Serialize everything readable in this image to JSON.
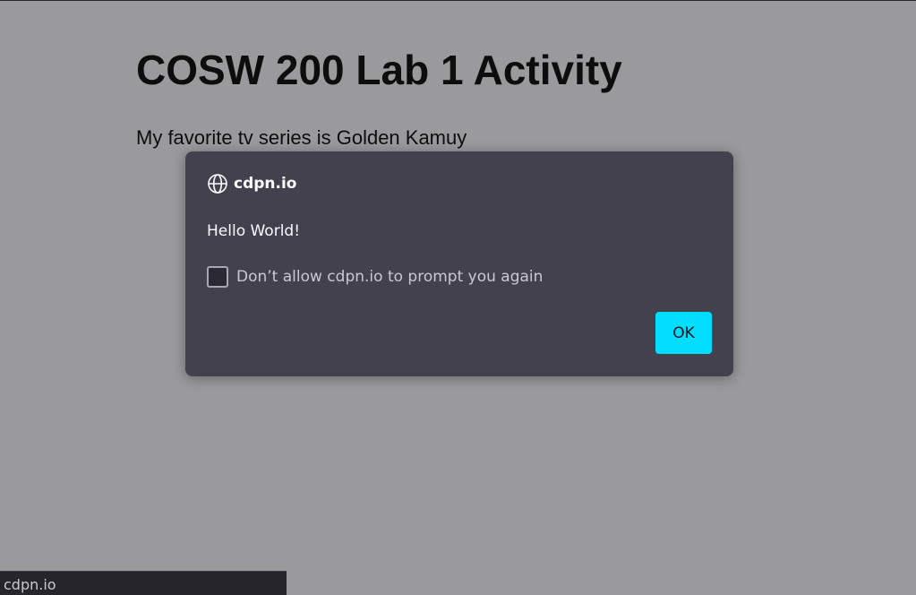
{
  "page": {
    "title": "COSW 200 Lab 1 Activity",
    "paragraph": "My favorite tv series is Golden Kamuy"
  },
  "dialog": {
    "origin": "cdpn.io",
    "origin_icon": "globe-icon",
    "message": "Hello World!",
    "checkbox_label": "Don’t allow cdpn.io to prompt you again",
    "checkbox_checked": false,
    "ok_label": "OK"
  },
  "status_bar": {
    "text": "cdpn.io"
  },
  "colors": {
    "overlay_background": "#9a9a9c",
    "dialog_background": "#42414d",
    "ok_button": "#00ddff",
    "status_bar_background": "#26252b"
  }
}
